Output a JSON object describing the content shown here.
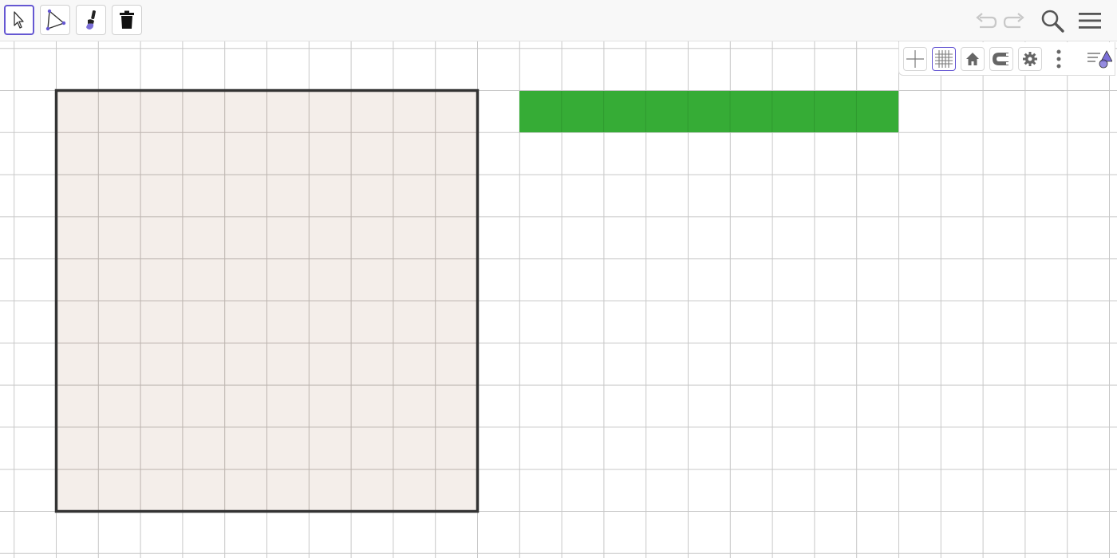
{
  "toolbar": {
    "tools": [
      {
        "id": "move",
        "icon": "cursor-arrow-icon",
        "selected": true
      },
      {
        "id": "polygon",
        "icon": "polygon-tool-icon",
        "selected": false
      },
      {
        "id": "style",
        "icon": "paintbrush-icon",
        "selected": false
      },
      {
        "id": "delete",
        "icon": "trash-icon",
        "selected": false
      }
    ],
    "right": [
      {
        "id": "undo",
        "icon": "undo-icon",
        "enabled": false
      },
      {
        "id": "redo",
        "icon": "redo-icon",
        "enabled": false
      },
      {
        "id": "search",
        "icon": "search-icon"
      },
      {
        "id": "menu",
        "icon": "hamburger-menu-icon"
      }
    ]
  },
  "style_bar": {
    "buttons": [
      {
        "id": "axes",
        "icon": "axes-icon",
        "selected": false
      },
      {
        "id": "grid",
        "icon": "grid-icon",
        "selected": true
      },
      {
        "id": "home",
        "icon": "home-icon"
      },
      {
        "id": "snap",
        "icon": "magnet-icon"
      },
      {
        "id": "settings",
        "icon": "gear-icon"
      },
      {
        "id": "more",
        "icon": "more-vertical-icon"
      },
      {
        "id": "toggle",
        "icon": "style-bar-toggle-icon"
      }
    ]
  },
  "canvas": {
    "grid": true,
    "grid_color": "#c8c8c8",
    "shapes": [
      {
        "id": "square",
        "kind": "polygon",
        "fill": "#f2ebe6",
        "stroke": "#333333",
        "width_units": 10,
        "height_units": 10
      },
      {
        "id": "strip",
        "kind": "polygon",
        "fill": "#36ac36",
        "stroke": "none",
        "width_units": 9,
        "height_units": 1
      }
    ]
  },
  "colors": {
    "accent": "#6557d2",
    "toolbar_bg": "#f8f8f8"
  }
}
